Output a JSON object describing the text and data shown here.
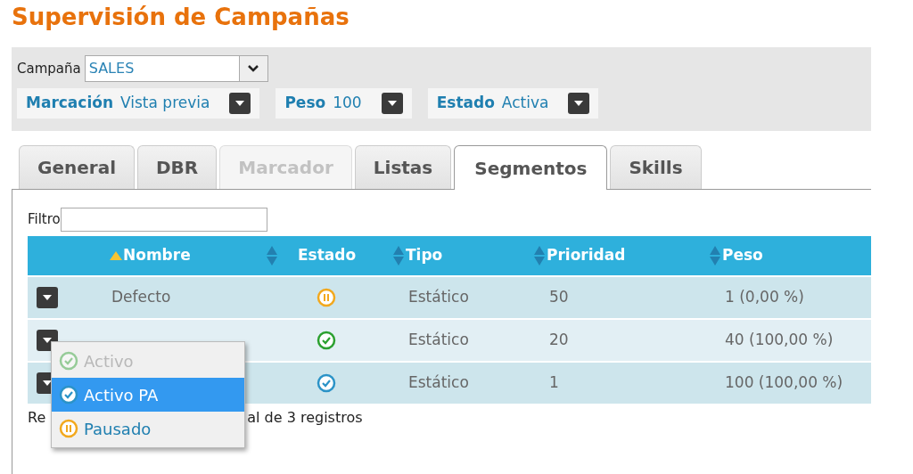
{
  "title": "Supervisión de Campañas",
  "campaign": {
    "label": "Campaña",
    "value": "SALES"
  },
  "filters": [
    {
      "label": "Marcación",
      "value": "Vista previa"
    },
    {
      "label": "Peso",
      "value": "100"
    },
    {
      "label": "Estado",
      "value": "Activa"
    }
  ],
  "tabs": [
    {
      "label": "General",
      "selected": false,
      "disabled": false
    },
    {
      "label": "DBR",
      "selected": false,
      "disabled": false
    },
    {
      "label": "Marcador",
      "selected": false,
      "disabled": true
    },
    {
      "label": "Listas",
      "selected": false,
      "disabled": false
    },
    {
      "label": "Segmentos",
      "selected": true,
      "disabled": false
    },
    {
      "label": "Skills",
      "selected": false,
      "disabled": false
    }
  ],
  "filter_field": {
    "label": "Filtro"
  },
  "table": {
    "columns": [
      {
        "label": "Nombre",
        "sorted": true
      },
      {
        "label": "Estado",
        "sorted": false
      },
      {
        "label": "Tipo",
        "sorted": false
      },
      {
        "label": "Prioridad",
        "sorted": false
      },
      {
        "label": "Peso",
        "sorted": false
      }
    ],
    "rows": [
      {
        "name": "Defecto",
        "kind": "paused",
        "type": "Estático",
        "priority": "50",
        "weight": "1 (0,00 %)"
      },
      {
        "kind": "active",
        "type": "Estático",
        "priority": "20",
        "weight": "40 (100,00 %)"
      },
      {
        "kind": "active_pa",
        "type": "Estático",
        "priority": "1",
        "weight": "100 (100,00 %)"
      }
    ]
  },
  "footer": [
    "Re",
    "al de 3 registros"
  ],
  "status_menu": [
    {
      "label": "Activo",
      "kind": "active",
      "disabled": true,
      "selected": false
    },
    {
      "label": "Activo PA",
      "kind": "active_pa",
      "disabled": false,
      "selected": true
    },
    {
      "label": "Pausado",
      "kind": "paused",
      "disabled": false,
      "selected": false
    }
  ]
}
